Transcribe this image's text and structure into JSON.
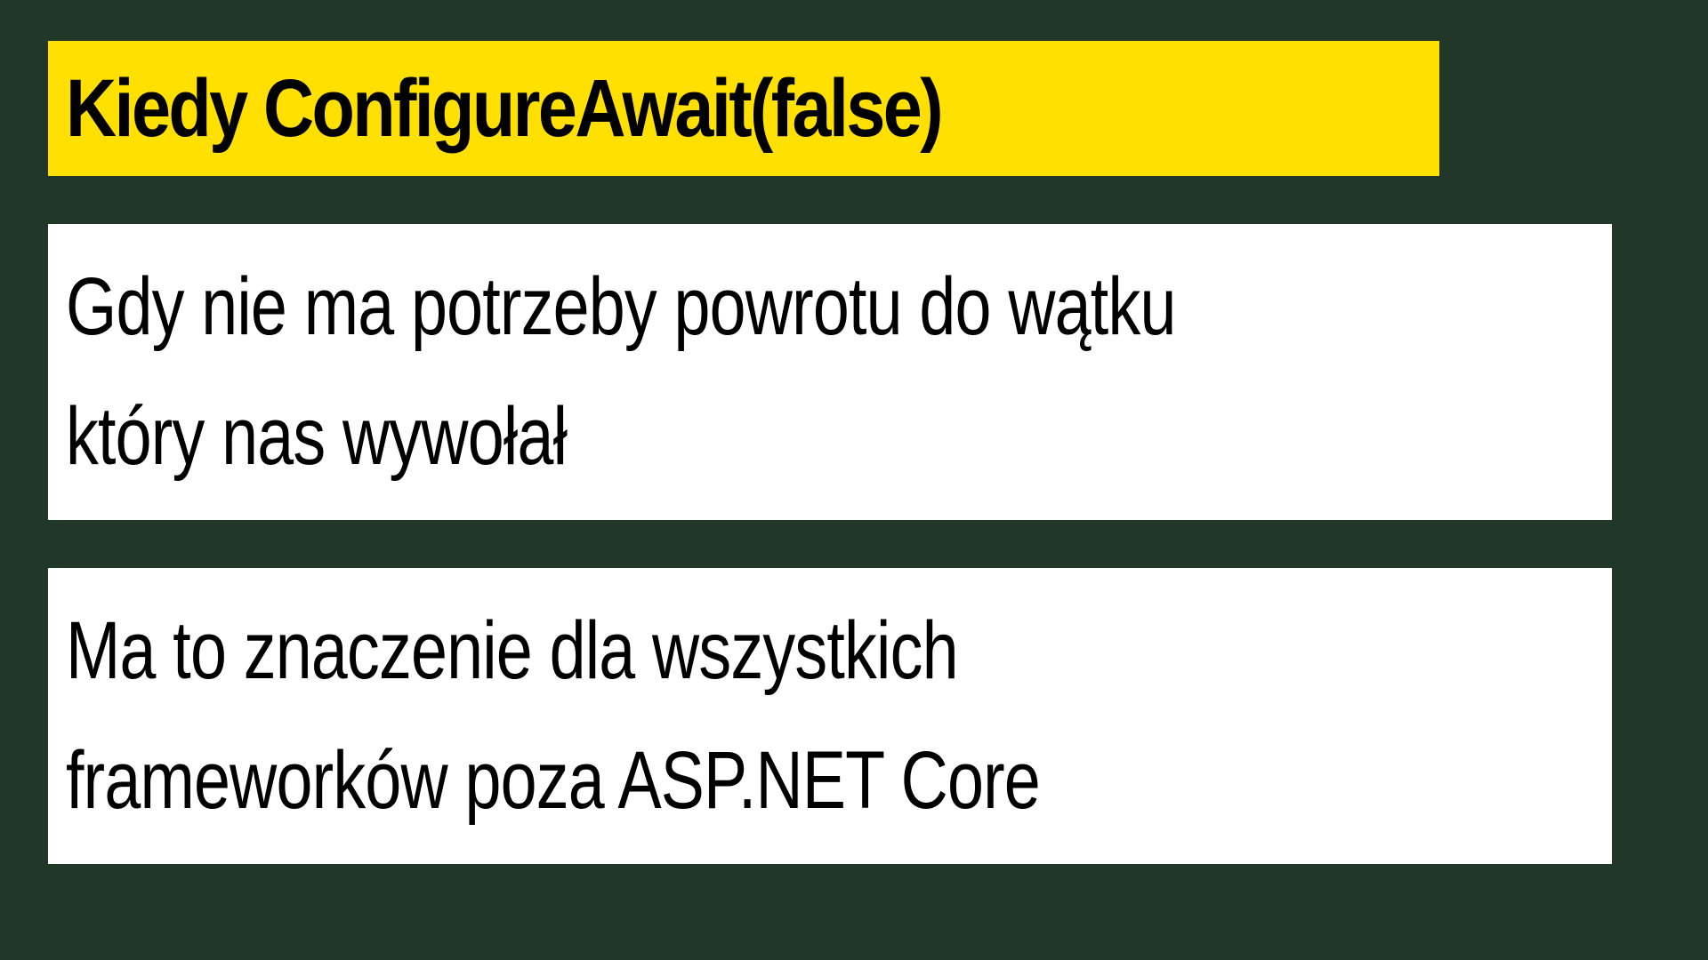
{
  "slide": {
    "title": "Kiedy ConfigureAwait(false)",
    "cards": [
      {
        "lines": [
          "Gdy nie ma potrzeby powrotu do wątku",
          "który nas wywołał"
        ]
      },
      {
        "lines": [
          "Ma to znaczenie dla wszystkich",
          "frameworków poza ASP.NET Core"
        ]
      }
    ]
  },
  "colors": {
    "background": "#213829",
    "title_bar": "#ffe000",
    "card": "#ffffff",
    "text": "#000000"
  }
}
